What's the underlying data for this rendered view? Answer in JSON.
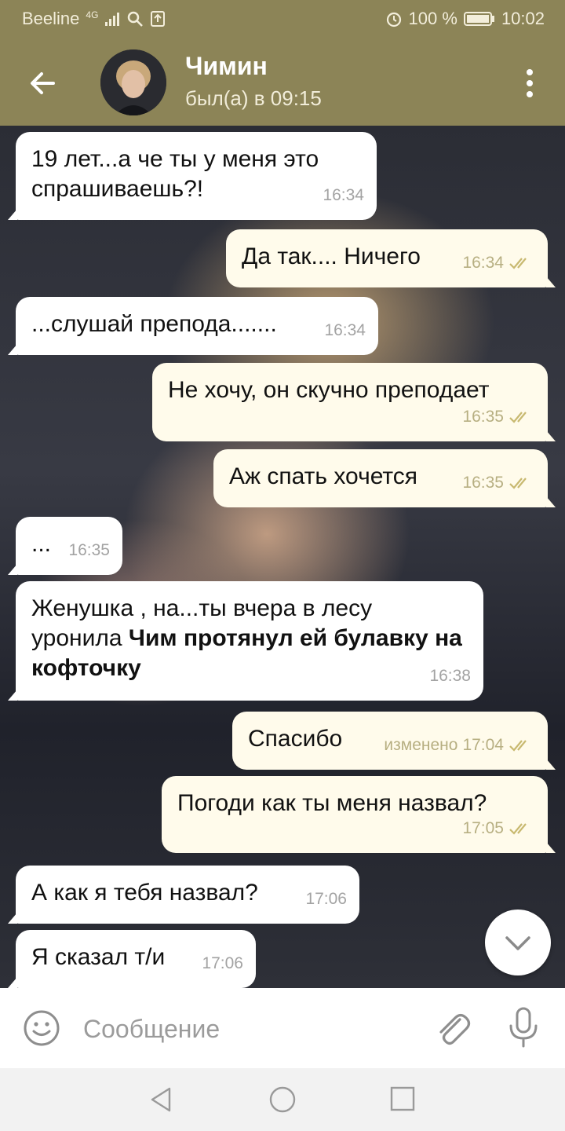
{
  "status_bar": {
    "carrier": "Beeline",
    "network": "4G",
    "battery": "100 %",
    "time": "10:02"
  },
  "header": {
    "title": "Чимин",
    "status": "был(а) в 09:15",
    "icons": [
      "back-arrow-icon",
      "more-vert-icon"
    ]
  },
  "messages": [
    {
      "direction": "in",
      "text": "19 лет...а че ты у меня это спрашиваешь?!",
      "time": "16:34"
    },
    {
      "direction": "out",
      "text": "Да так.... Ничего",
      "time": "16:34",
      "read": true
    },
    {
      "direction": "in",
      "text": "...слушай препода.......",
      "time": "16:34"
    },
    {
      "direction": "out",
      "text": "Не хочу, он скучно преподает",
      "time": "16:35",
      "read": true
    },
    {
      "direction": "out",
      "text": "Аж спать хочется",
      "time": "16:35",
      "read": true
    },
    {
      "direction": "in",
      "text": "...",
      "time": "16:35"
    },
    {
      "direction": "in",
      "text": "Женушка , на...ты вчера в лесу уронила ",
      "text_bold": "Чим протянул ей булавку на кофточку",
      "time": "16:38"
    },
    {
      "direction": "out",
      "text": "Спасибо",
      "edited": "изменено",
      "time": "17:04",
      "read": true
    },
    {
      "direction": "out",
      "text": "Погоди как ты меня назвал?",
      "time": "17:05",
      "read": true
    },
    {
      "direction": "in",
      "text": "А как я тебя назвал?",
      "time": "17:06"
    },
    {
      "direction": "in",
      "text": "Я сказал т/и",
      "time": "17:06"
    }
  ],
  "composer": {
    "placeholder": "Сообщение",
    "icons": [
      "emoji-icon",
      "attach-icon",
      "mic-icon"
    ]
  },
  "colors": {
    "header_bg": "#8c8457",
    "outgoing_bubble": "#fffbeb",
    "incoming_bubble": "#ffffff",
    "tick_color": "#c8b970"
  }
}
